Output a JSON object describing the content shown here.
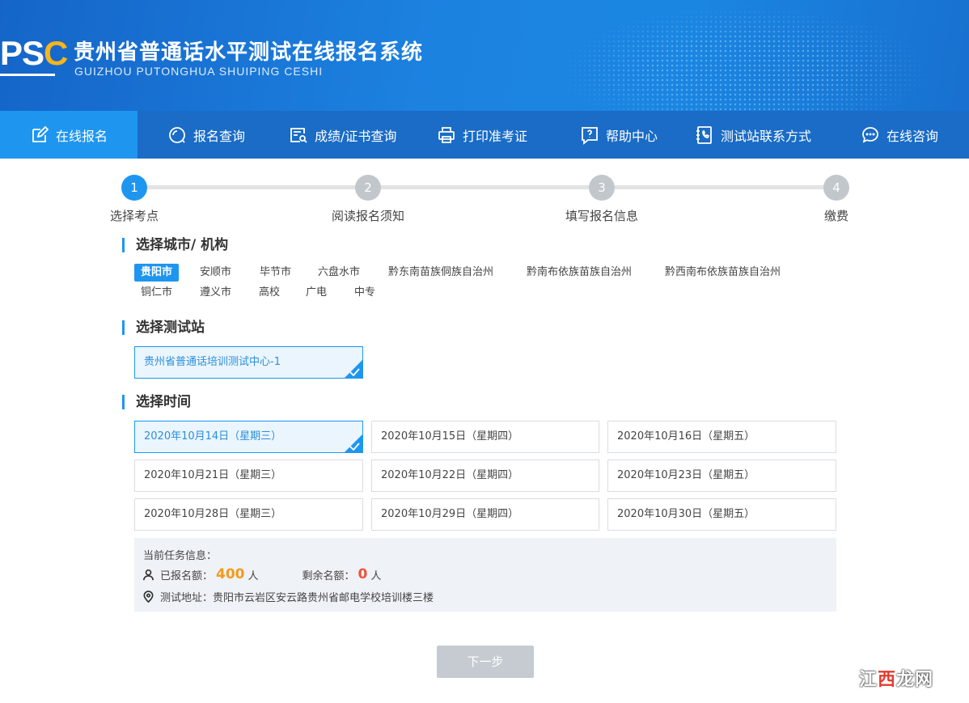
{
  "header": {
    "logo_ps": "PS",
    "logo_c": "C",
    "title": "贵州省普通话水平测试在线报名系统",
    "subtitle": "GUIZHOU PUTONGHUA SHUIPING CESHI"
  },
  "nav": [
    {
      "label": "在线报名",
      "icon": "edit-icon",
      "active": true
    },
    {
      "label": "报名查询",
      "icon": "search-icon"
    },
    {
      "label": "成绩/证书查询",
      "icon": "certificate-search-icon"
    },
    {
      "label": "打印准考证",
      "icon": "printer-icon"
    },
    {
      "label": "帮助中心",
      "icon": "help-icon"
    },
    {
      "label": "测试站联系方式",
      "icon": "phone-book-icon"
    },
    {
      "label": "在线咨询",
      "icon": "chat-icon"
    }
  ],
  "steps": [
    {
      "num": "1",
      "label": "选择考点",
      "active": true
    },
    {
      "num": "2",
      "label": "阅读报名须知"
    },
    {
      "num": "3",
      "label": "填写报名信息"
    },
    {
      "num": "4",
      "label": "缴费"
    }
  ],
  "city_section": {
    "title": "选择城市/ 机构",
    "items": [
      "贵阳市",
      "安顺市",
      "毕节市",
      "六盘水市",
      "黔东南苗族侗族自治州",
      "黔南布依族苗族自治州",
      "黔西南布依族苗族自治州",
      "铜仁市",
      "遵义市",
      "高校",
      "广电",
      "中专"
    ],
    "selected": "贵阳市"
  },
  "station_section": {
    "title": "选择测试站",
    "items": [
      "贵州省普通话培训测试中心-1"
    ]
  },
  "time_section": {
    "title": "选择时间",
    "items": [
      "2020年10月14日（星期三）",
      "2020年10月15日（星期四）",
      "2020年10月16日（星期五）",
      "2020年10月21日（星期三）",
      "2020年10月22日（星期四）",
      "2020年10月23日（星期五）",
      "2020年10月28日（星期三）",
      "2020年10月29日（星期四）",
      "2020年10月30日（星期五）"
    ]
  },
  "task_info": {
    "title": "当前任务信息：",
    "registered_label": "已报名额：",
    "registered_value": "400",
    "registered_unit": "人",
    "remaining_label": "剩余名额：",
    "remaining_value": "0",
    "remaining_unit": "人",
    "address_label": "测试地址：",
    "address_value": "贵阳市云岩区安云路贵州省邮电学校培训楼三楼"
  },
  "next_button": "下一步",
  "watermark": {
    "part1": "江",
    "part2": "西",
    "part3": "龙网"
  },
  "colors": {
    "accent": "#1e96f0",
    "header": "#1a6cc6",
    "orange": "#f39a1c",
    "red": "#f0523c"
  }
}
